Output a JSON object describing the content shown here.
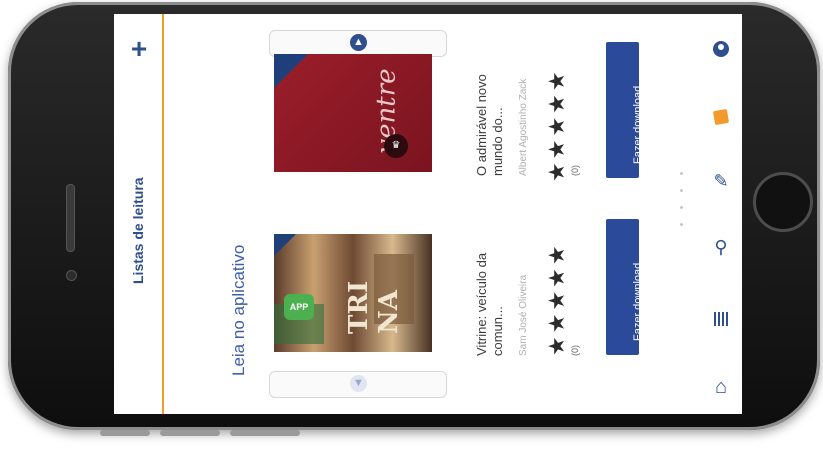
{
  "sidebar": {
    "add_label": "+",
    "title": "Listas de leitura"
  },
  "section": {
    "title": "Leia no aplicativo"
  },
  "books": [
    {
      "title_line1": "O admirável novo",
      "title_line2": "mundo do...",
      "author": "Albert Agostinho Zack",
      "stars": "★★★★★",
      "rating_count": "(0)",
      "download_label": "Fazer download",
      "cover_script": "ventre"
    },
    {
      "title_line1": "Vitrine: veículo da",
      "title_line2": "comun...",
      "author": "Sam José Oliveira",
      "stars": "★★★★★",
      "rating_count": "(0)",
      "download_label": "Fazer download",
      "cover_text": "TRI NA",
      "badge": "APP"
    }
  ],
  "toolbar": {
    "icons": [
      "user-icon",
      "notes-icon",
      "edit-icon",
      "search-icon",
      "list-icon",
      "home-icon"
    ]
  },
  "colors": {
    "accent_blue": "#2b4b9a",
    "accent_orange": "#f39a2c"
  }
}
